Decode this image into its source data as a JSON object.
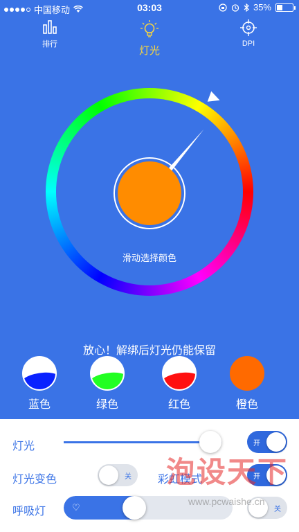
{
  "status_bar": {
    "carrier": "中国移动",
    "time": "03:03",
    "battery": "35%",
    "battery_level": 0.35
  },
  "nav": {
    "rank_label": "排行",
    "light_label": "灯光",
    "dpi_label": "DPI"
  },
  "color_wheel": {
    "hint": "滑动选择颜色",
    "selected_color": "#ff8c00"
  },
  "notice": "放心！解绑后灯光仍能保留",
  "presets": [
    {
      "label": "蓝色",
      "color": "#0a22ff"
    },
    {
      "label": "绿色",
      "color": "#22ff22"
    },
    {
      "label": "红色",
      "color": "#ff1010"
    },
    {
      "label": "橙色",
      "color": "#ff6a00"
    }
  ],
  "controls": {
    "light": {
      "label": "灯光",
      "brightness": 0.93,
      "toggle": "开"
    },
    "light_change": {
      "label": "灯光变色",
      "toggle": "关"
    },
    "rainbow": {
      "label": "彩虹模式",
      "toggle": "开"
    },
    "breath": {
      "label": "呼吸灯",
      "speed": 0.42,
      "toggle": "关"
    }
  },
  "watermark": {
    "title": "泡设天下",
    "url": "www.pcwaishe.cn"
  },
  "colors": {
    "primary": "#3a73e6",
    "accent": "#f5d442"
  }
}
